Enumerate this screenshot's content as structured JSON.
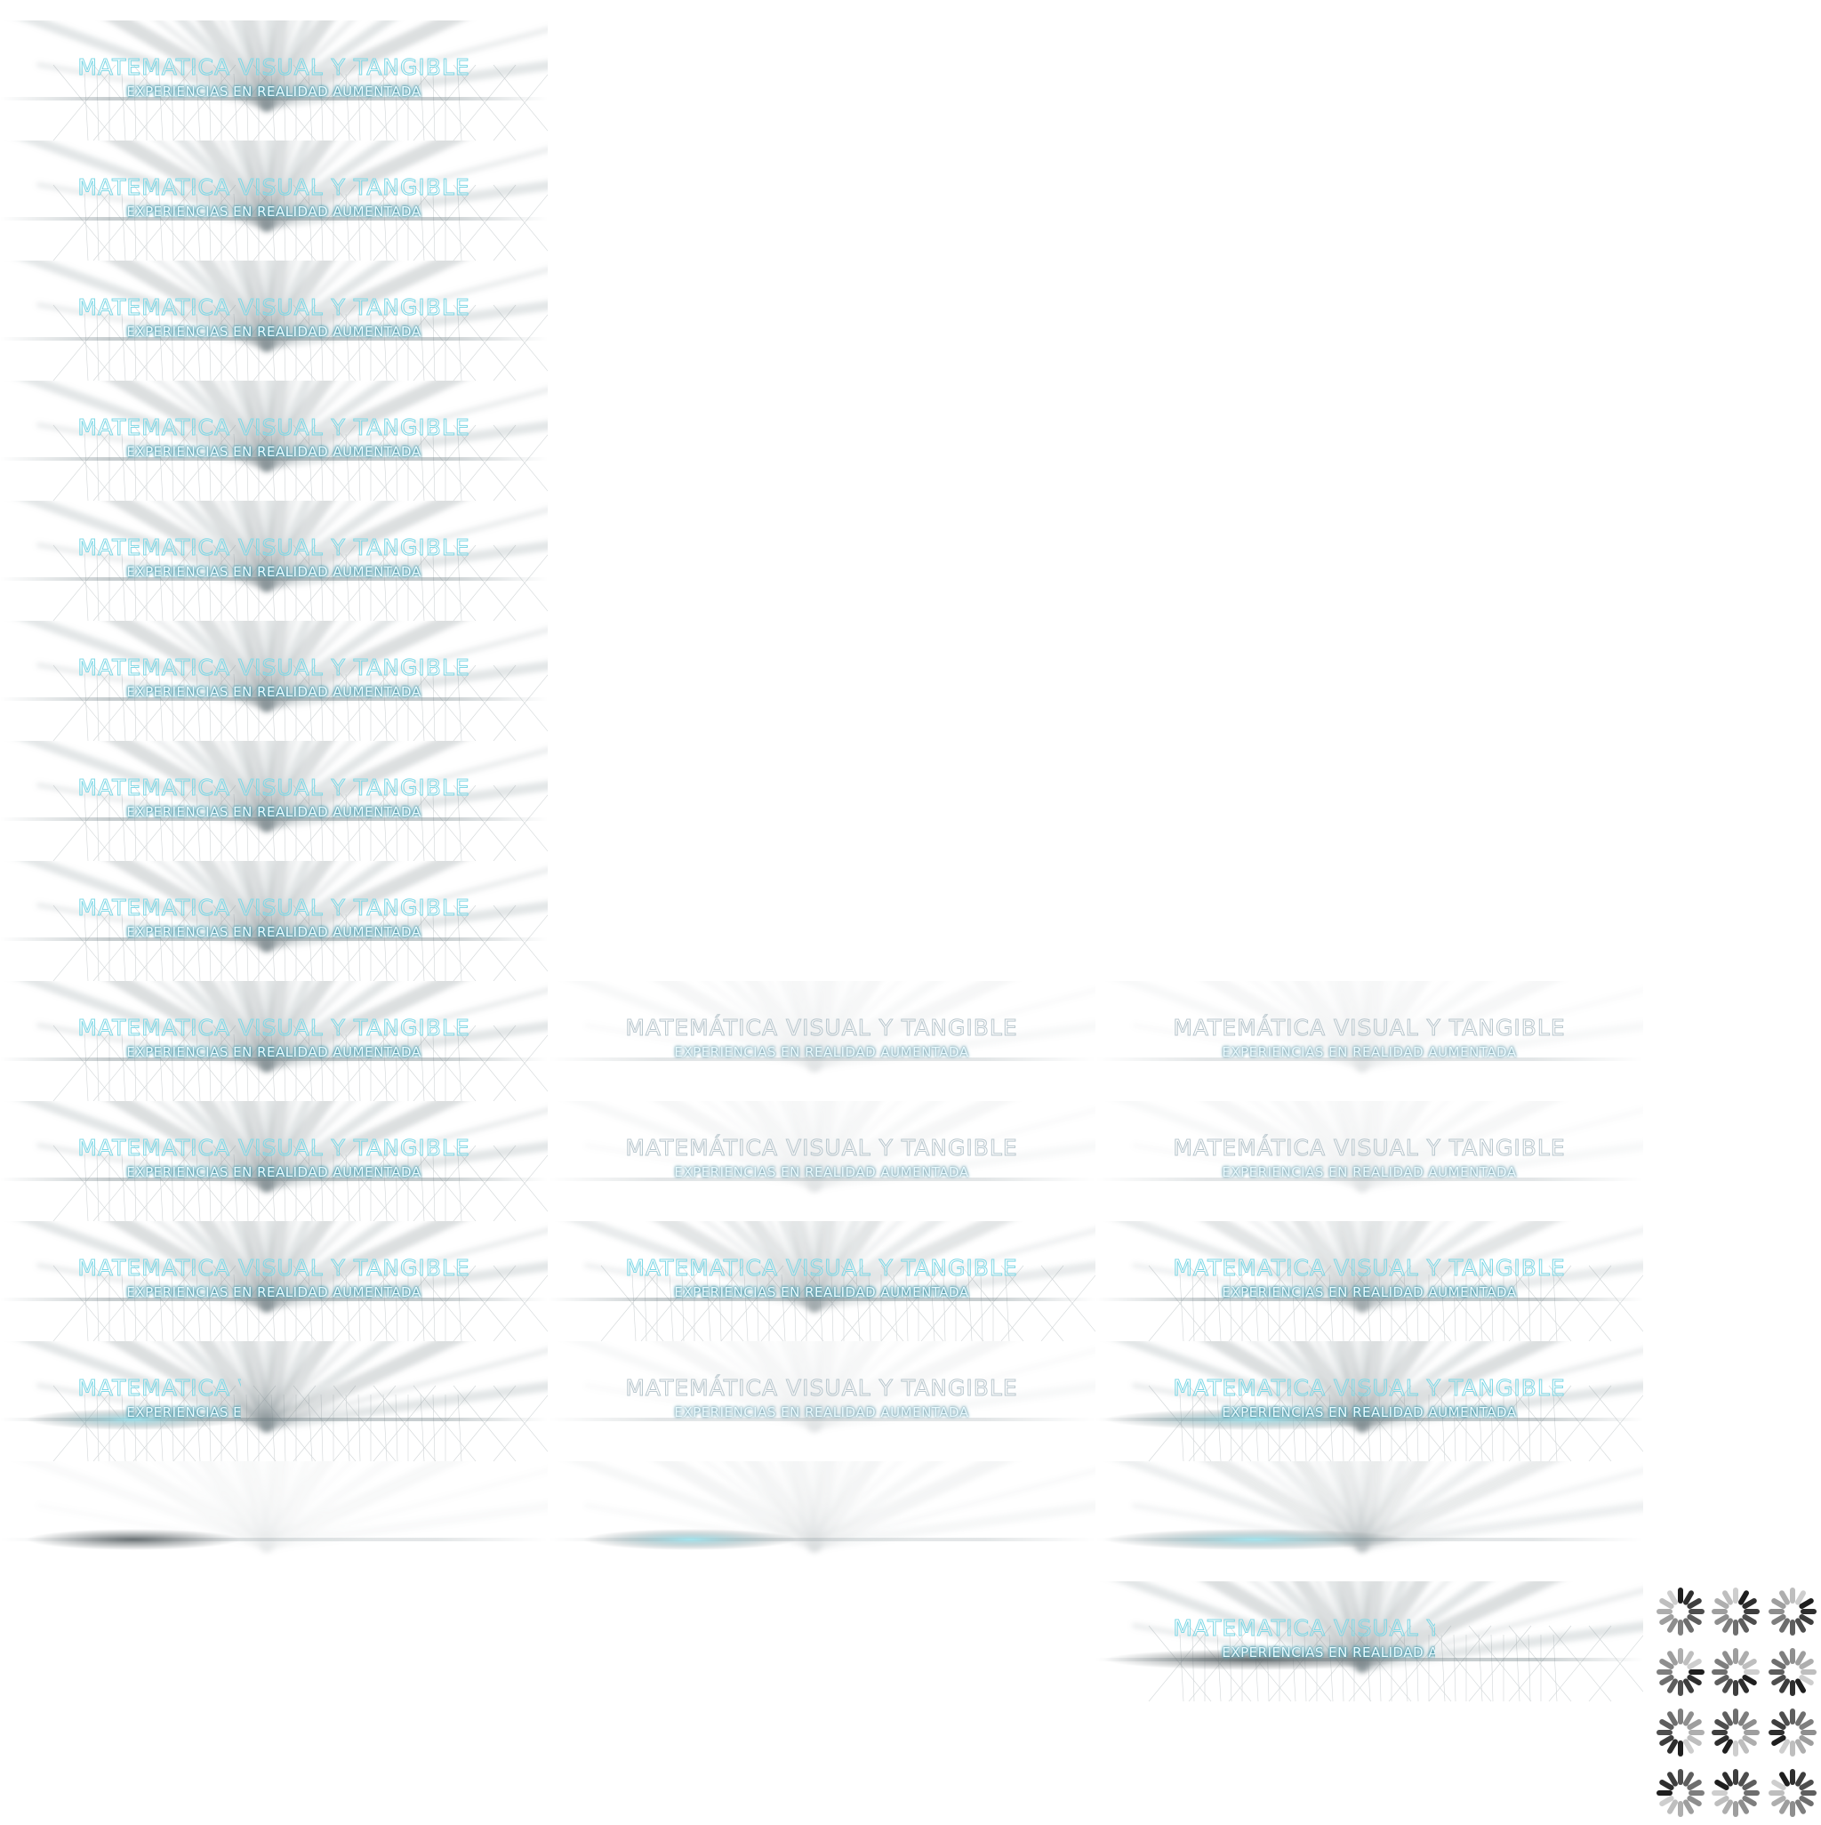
{
  "title_text": "MATEMÁTICA VISUAL Y TANGIBLE",
  "title_text_alt": "MATEMATICA VISUAL Y TANGIBLE",
  "subtitle_text": "EXPERIENCIAS EN REALIDAD AUMENTADA",
  "colors": {
    "accent": "#7fd8e6",
    "glow": "#69c9dd",
    "ray": "#8a9599",
    "background": "#ffffff"
  },
  "icons": [
    "loading-spinner-icon"
  ]
}
